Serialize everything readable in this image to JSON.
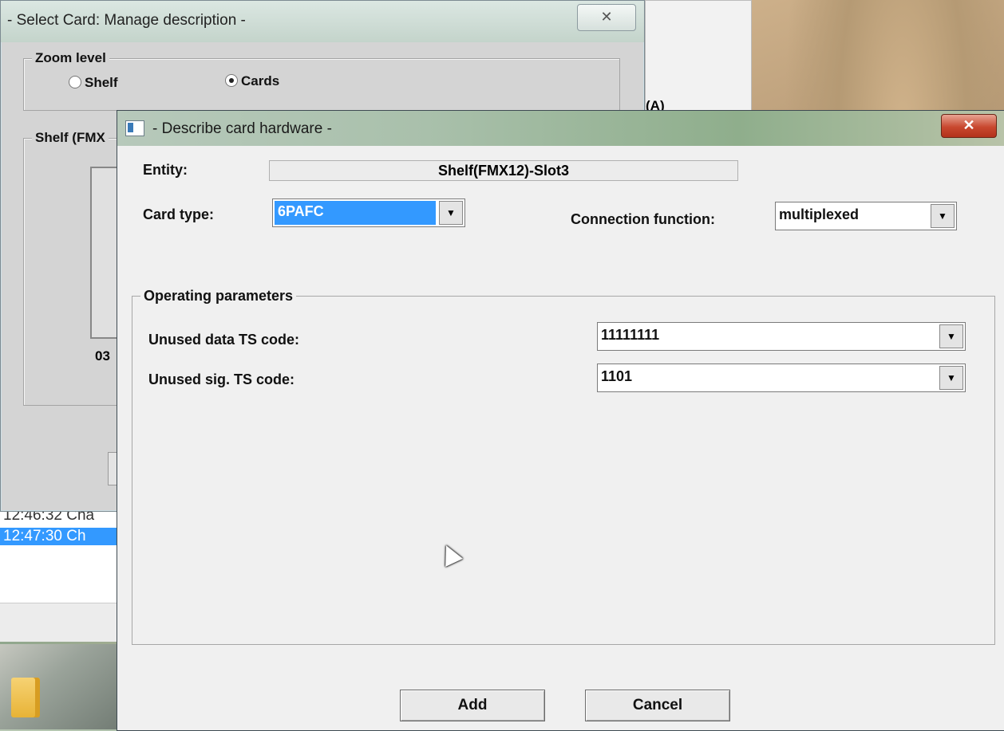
{
  "back_window": {
    "title": "- Select Card: Manage description -",
    "close_glyph": "✕",
    "zoom_group": "Zoom level",
    "radio_shelf": "Shelf",
    "radio_cards": "Cards",
    "shelf_group": "Shelf (FMX",
    "slot_label": "03",
    "partial_right": "(A)"
  },
  "log": {
    "rows": [
      "12:46:32 Cha",
      "12:47:30 Ch"
    ]
  },
  "dialog": {
    "title": "- Describe card hardware -",
    "close_glyph": "✕",
    "entity_label": "Entity:",
    "entity_value": "Shelf(FMX12)-Slot3",
    "card_type_label": "Card type:",
    "card_type_value": "6PAFC",
    "connection_label": "Connection function:",
    "connection_value": "multiplexed",
    "operating_group": "Operating parameters",
    "unused_data_label": "Unused data TS code:",
    "unused_data_value": "11111111",
    "unused_sig_label": "Unused sig. TS code:",
    "unused_sig_value": "1101",
    "add_label": "Add",
    "cancel_label": "Cancel",
    "dropdown_glyph": "▼"
  }
}
